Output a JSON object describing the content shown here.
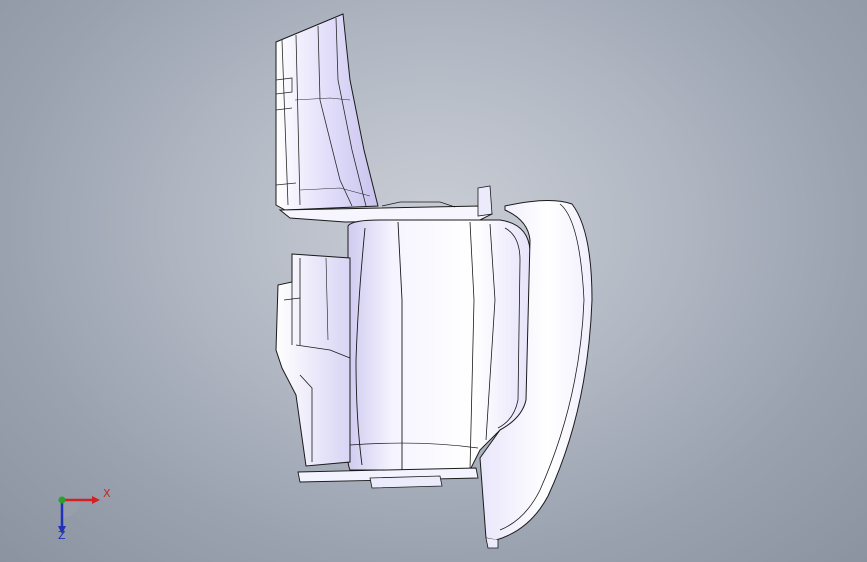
{
  "viewport": {
    "background_top": "#c9cdd5",
    "background_bottom": "#8b93a1"
  },
  "model": {
    "face_color": "#f4f2ff",
    "shade_color": "#d6d2f4",
    "edge_color": "#1a1a1a"
  },
  "triad": {
    "x_label": "X",
    "z_label": "Z",
    "x_color": "#d42020",
    "y_color": "#2aa02a",
    "z_color": "#2030b8"
  }
}
